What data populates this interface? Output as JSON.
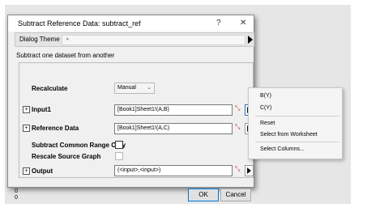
{
  "window": {
    "title": "Subtract Reference Data: subtract_ref",
    "help_glyph": "?",
    "close_glyph": "✕"
  },
  "dialog_theme": {
    "label": "Dialog Theme",
    "value": "",
    "arrow_glyph": "▸"
  },
  "description": "Subtract one dataset from another",
  "form": {
    "recalculate": {
      "label": "Recalculate",
      "value": "Manual"
    },
    "input1": {
      "label": "Input1",
      "value": "[Book1]Sheet1!(A,B)"
    },
    "reference": {
      "label": "Reference Data",
      "value": "[Book1]Sheet1!(A,C)"
    },
    "common_range": {
      "label": "Subtract Common Range Only"
    },
    "rescale": {
      "label": "Rescale Source Graph"
    },
    "output": {
      "label": "Output",
      "value": "(<input>,<input>)"
    },
    "expander_glyph": "+",
    "chevron_glyph": "⌄"
  },
  "buttons": {
    "ok": "OK",
    "cancel": "Cancel"
  },
  "menu": {
    "items": [
      "B(Y)",
      "C(Y)",
      "Reset",
      "Select from Worksheet",
      "Select Columns..."
    ]
  },
  "background_text": [
    "0",
    "0"
  ]
}
